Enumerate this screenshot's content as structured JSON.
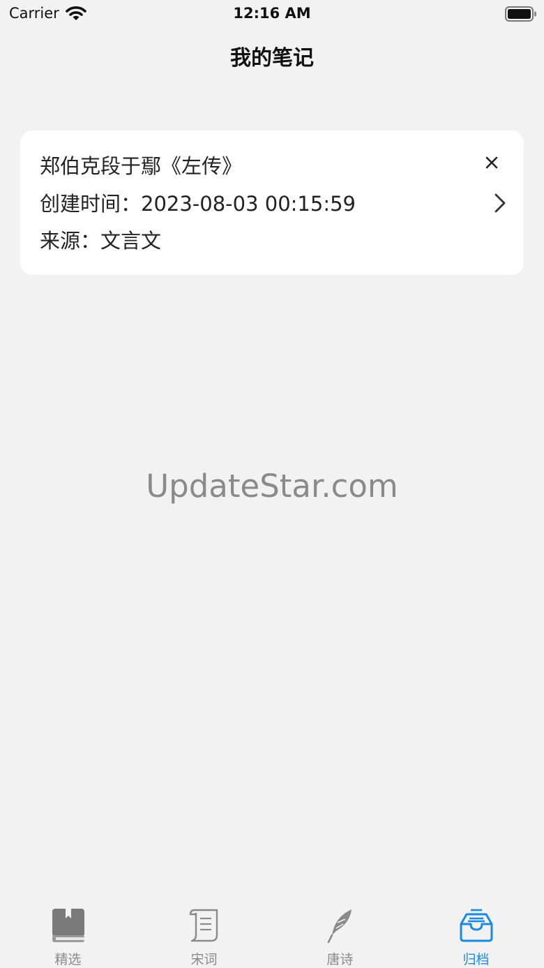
{
  "status_bar": {
    "carrier": "Carrier",
    "time": "12:16 AM"
  },
  "nav": {
    "title": "我的笔记"
  },
  "note": {
    "title": "郑伯克段于鄢《左传》",
    "created": "创建时间：2023-08-03 00:15:59",
    "source": "来源：文言文"
  },
  "watermark": "UpdateStar.com",
  "tabs": [
    {
      "label": "精选",
      "icon": "book-icon",
      "active": false
    },
    {
      "label": "宋词",
      "icon": "scroll-icon",
      "active": false
    },
    {
      "label": "唐诗",
      "icon": "feather-icon",
      "active": false
    },
    {
      "label": "归档",
      "icon": "archive-tray-icon",
      "active": true
    }
  ],
  "colors": {
    "accent": "#1a8ae0",
    "background": "#f2f2f2",
    "card": "#ffffff",
    "inactive_tab": "#8a8a8a"
  }
}
